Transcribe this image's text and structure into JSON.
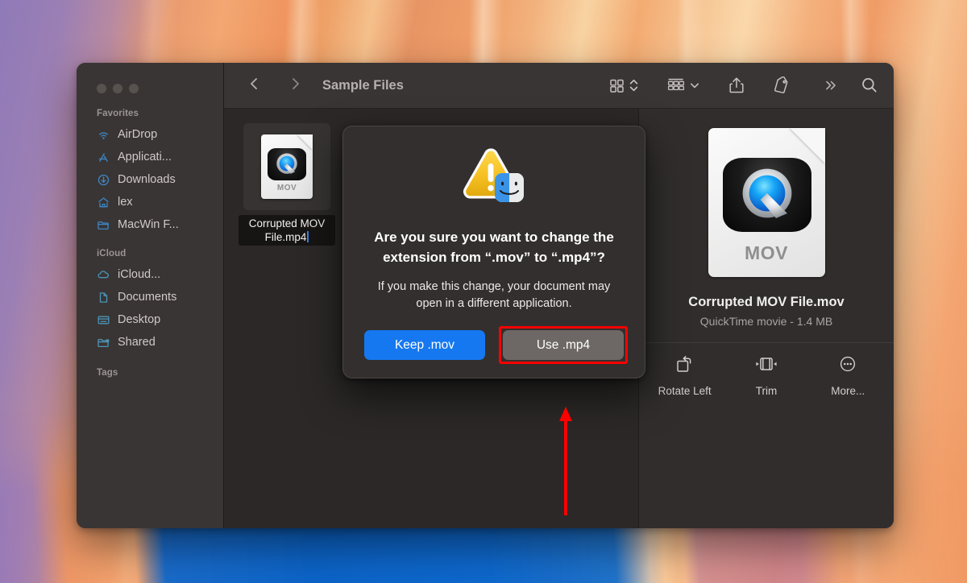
{
  "window": {
    "title": "Sample Files",
    "traffic_lights": [
      "close",
      "minimize",
      "maximize"
    ]
  },
  "toolbar": {
    "back_icon": "chevron-left-icon",
    "forward_icon": "chevron-right-icon",
    "view_icon": "grid-view-icon",
    "view_sort_icon": "chevron-up-down-icon",
    "group_icon": "group-by-icon",
    "group_chevron_icon": "chevron-down-icon",
    "share_icon": "share-icon",
    "tag_icon": "tag-icon",
    "more_icon": "double-chevron-right-icon",
    "search_icon": "search-icon"
  },
  "sidebar": {
    "sections": [
      {
        "title": "Favorites",
        "items": [
          {
            "label": "AirDrop",
            "icon": "airdrop-icon"
          },
          {
            "label": "Applicati...",
            "icon": "applications-icon"
          },
          {
            "label": "Downloads",
            "icon": "downloads-icon"
          },
          {
            "label": "lex",
            "icon": "home-icon"
          },
          {
            "label": "MacWin F...",
            "icon": "folder-icon"
          }
        ]
      },
      {
        "title": "iCloud",
        "items": [
          {
            "label": "iCloud...",
            "icon": "cloud-icon"
          },
          {
            "label": "Documents",
            "icon": "document-icon"
          },
          {
            "label": "Desktop",
            "icon": "desktop-icon"
          },
          {
            "label": "Shared",
            "icon": "shared-folder-icon"
          }
        ]
      },
      {
        "title": "Tags",
        "items": []
      }
    ]
  },
  "files": {
    "items": [
      {
        "name_edit_value": "Corrupted MOV File.mp4",
        "icon_label": "MOV",
        "icon": "quicktime-document-icon",
        "selected": true,
        "renaming": true
      }
    ]
  },
  "preview": {
    "icon": "quicktime-document-icon",
    "icon_label": "MOV",
    "filename": "Corrupted MOV File.mov",
    "meta": "QuickTime movie - 1.4 MB",
    "actions": [
      {
        "label": "Rotate Left",
        "icon": "rotate-left-icon"
      },
      {
        "label": "Trim",
        "icon": "trim-icon"
      },
      {
        "label": "More...",
        "icon": "more-circle-icon"
      }
    ]
  },
  "dialog": {
    "icon": "finder-warning-icon",
    "title": "Are you sure you want to change the extension from “.mov” to “.mp4”?",
    "body": "If you make this change, your document may open in a different application.",
    "buttons": [
      {
        "label": "Keep .mov",
        "style": "primary"
      },
      {
        "label": "Use .mp4",
        "style": "secondary",
        "highlighted": true
      }
    ]
  },
  "annotation": {
    "arrow_color": "#fe0000",
    "highlight_color": "#fe0000",
    "points_to": "Use .mp4"
  },
  "colors": {
    "accent_blue": "#1578f0",
    "window_chrome": "#393534",
    "content_bg": "#2b2827",
    "dialog_bg": "#332f2e",
    "sidebar_icon_blue": "#3d86c6"
  }
}
